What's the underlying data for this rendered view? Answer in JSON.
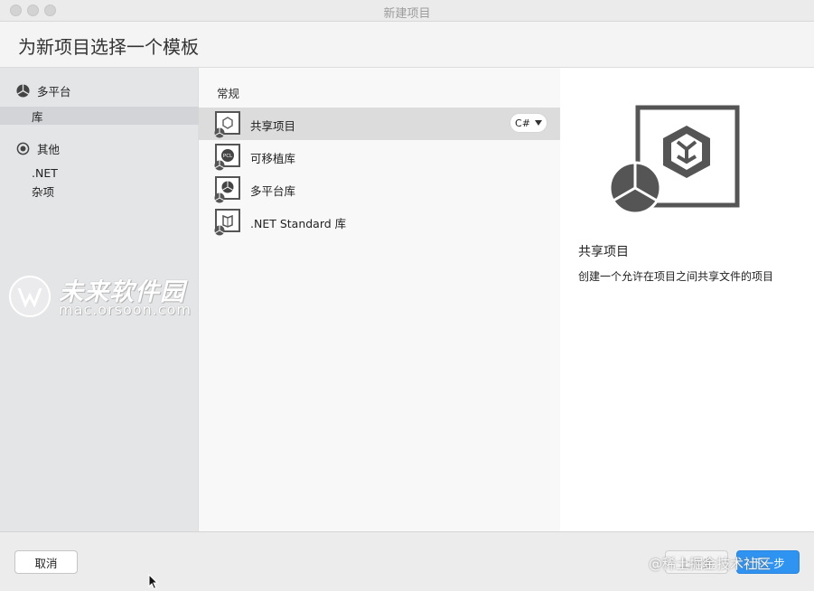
{
  "window": {
    "title": "新建项目"
  },
  "header": {
    "title": "为新项目选择一个模板"
  },
  "sidebar": {
    "categories": [
      {
        "label": "多平台",
        "icon": "multiplatform-icon",
        "items": [
          {
            "label": "库",
            "selected": true
          }
        ]
      },
      {
        "label": "其他",
        "icon": "target-icon",
        "items": [
          {
            "label": ".NET",
            "selected": false
          },
          {
            "label": "杂项",
            "selected": false
          }
        ]
      }
    ]
  },
  "watermark": {
    "brand": "未来软件园",
    "url": "mac.orsoon.com"
  },
  "templates": {
    "group_label": "常规",
    "items": [
      {
        "name": "共享项目",
        "icon": "shared-project-icon",
        "selected": true,
        "language": "C#"
      },
      {
        "name": "可移植库",
        "icon": "portable-library-icon",
        "icon_text": "PCL",
        "selected": false
      },
      {
        "name": "多平台库",
        "icon": "multiplatform-library-icon",
        "selected": false
      },
      {
        "name": ".NET Standard 库",
        "icon": "net-standard-library-icon",
        "selected": false
      }
    ]
  },
  "detail": {
    "title": "共享项目",
    "description": "创建一个允许在项目之间共享文件的项目",
    "icon": "shared-project-large-icon"
  },
  "footer": {
    "cancel_label": "取消",
    "prev_label": "上一步",
    "next_label": "下一步",
    "credit": "@稀土掘金技术社区"
  },
  "colors": {
    "accent": "#2f93f1",
    "selected_row": "#dcdcdc",
    "sidebar_bg": "#e4e5e7",
    "icon_gray": "#555555"
  }
}
